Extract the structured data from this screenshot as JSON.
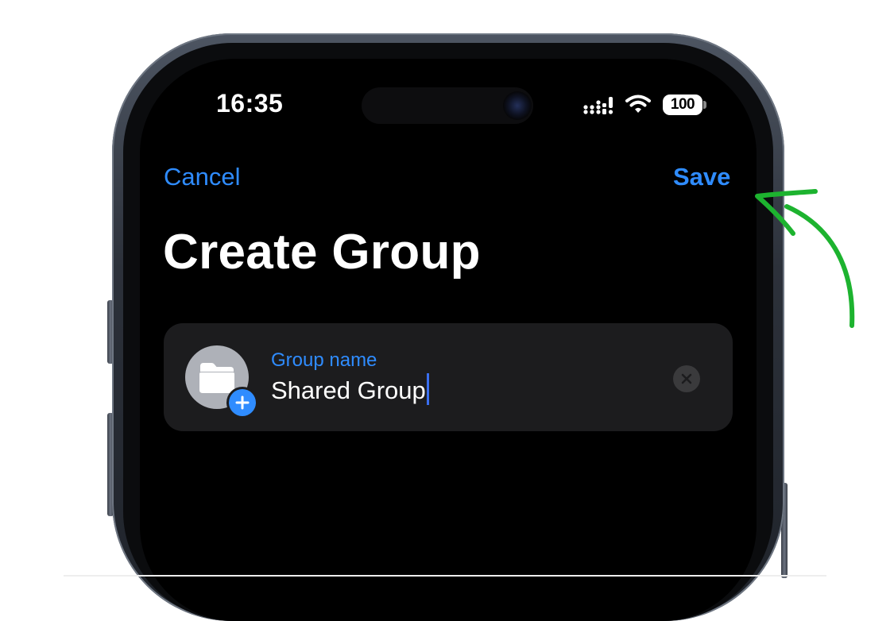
{
  "status_bar": {
    "time": "16:35",
    "battery": "100",
    "signal_icon": "cellular-signal-icon",
    "wifi_icon": "wifi-icon"
  },
  "nav": {
    "cancel_label": "Cancel",
    "save_label": "Save"
  },
  "title": "Create Group",
  "group_card": {
    "avatar_icon": "folder-icon",
    "add_icon": "plus-icon",
    "field_label": "Group name",
    "field_value": "Shared Group",
    "clear_icon": "xmark-icon"
  },
  "annotation": {
    "arrow_icon": "curved-arrow-icon",
    "arrow_color": "#1db32f"
  },
  "colors": {
    "accent": "#2f8cff",
    "background": "#000000",
    "card": "#1c1c1e"
  }
}
